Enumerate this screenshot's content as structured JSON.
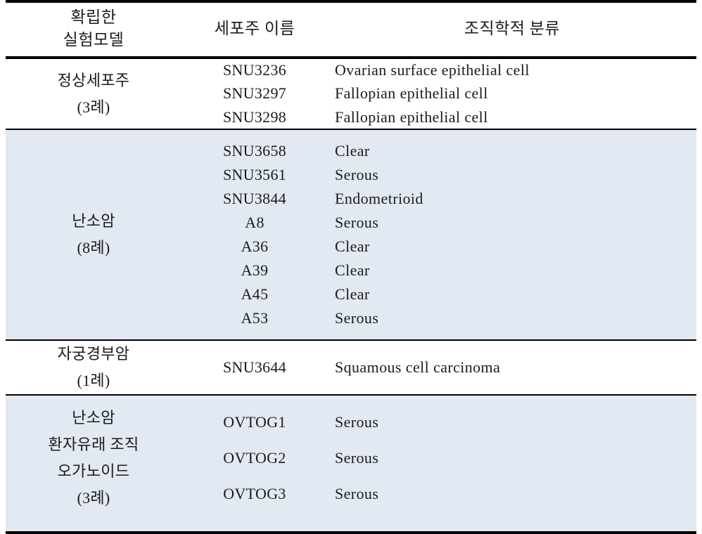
{
  "table": {
    "columns": [
      {
        "id": "model",
        "lines": [
          "확립한",
          "실험모델"
        ]
      },
      {
        "id": "name",
        "lines": [
          "세포주 이름"
        ]
      },
      {
        "id": "hist",
        "lines": [
          "조직학적 분류"
        ]
      }
    ],
    "colors": {
      "shaded_row_bg": "#e3e9f2",
      "rule": "#000000",
      "text": "#1a1a22",
      "page_bg": "#ffffff"
    },
    "sections": [
      {
        "id": "normal-cell-lines",
        "shaded": false,
        "model_lines": [
          "정상세포주",
          "(3례)"
        ],
        "rows": [
          {
            "name": "SNU3236",
            "histology": "Ovarian surface epithelial cell"
          },
          {
            "name": "SNU3297",
            "histology": "Fallopian epithelial cell"
          },
          {
            "name": "SNU3298",
            "histology": "Fallopian epithelial cell"
          }
        ]
      },
      {
        "id": "ovarian-cancer",
        "shaded": true,
        "model_lines": [
          "난소암",
          "(8례)"
        ],
        "rows": [
          {
            "name": "SNU3658",
            "histology": "Clear"
          },
          {
            "name": "SNU3561",
            "histology": "Serous"
          },
          {
            "name": "SNU3844",
            "histology": "Endometrioid"
          },
          {
            "name": "A8",
            "histology": "Serous"
          },
          {
            "name": "A36",
            "histology": "Clear"
          },
          {
            "name": "A39",
            "histology": "Clear"
          },
          {
            "name": "A45",
            "histology": "Clear"
          },
          {
            "name": "A53",
            "histology": "Serous"
          }
        ]
      },
      {
        "id": "cervical-cancer",
        "shaded": false,
        "model_lines": [
          "자궁경부암",
          "(1례)"
        ],
        "rows": [
          {
            "name": "SNU3644",
            "histology": "Squamous cell carcinoma"
          }
        ]
      },
      {
        "id": "ovarian-cancer-patient-derived-organoid",
        "shaded": true,
        "model_lines": [
          "난소암",
          "환자유래 조직",
          "오가노이드",
          "(3례)"
        ],
        "rows": [
          {
            "name": "OVTOG1",
            "histology": "Serous"
          },
          {
            "name": "OVTOG2",
            "histology": "Serous"
          },
          {
            "name": "OVTOG3",
            "histology": "Serous"
          }
        ]
      }
    ]
  }
}
